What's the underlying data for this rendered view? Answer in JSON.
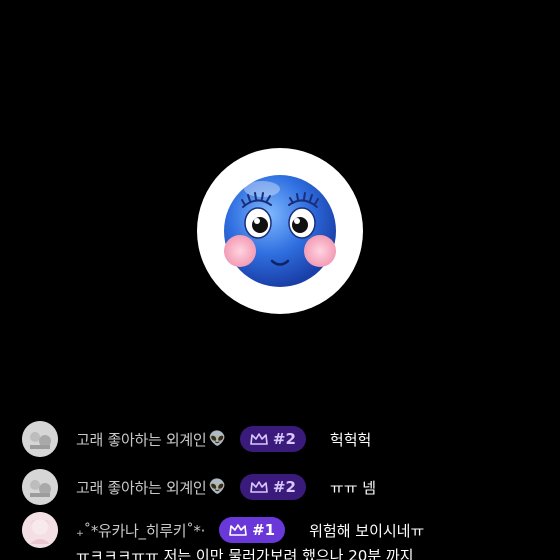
{
  "profile": {
    "icon": "blue-blushing-smiley-icon"
  },
  "colors": {
    "background": "#000000",
    "badge_rank2": "#3a1a7a",
    "badge_rank1": "#6a38d8"
  },
  "chat": [
    {
      "nickname": "고래 좋아하는 외계인",
      "emoji": "👽",
      "badge": "#2",
      "message": "헉헉헉"
    },
    {
      "nickname": "고래 좋아하는 외계인",
      "emoji": "👽",
      "badge": "#2",
      "message": "ㅠㅠ 넴"
    },
    {
      "nickname": "₊˚*유카나_히루키˚*·",
      "emoji": "",
      "badge": "#1",
      "message": "위험해 보이시네ㅠ",
      "message_continued": "ㅠㅋㅋㅋㅠㅠ 저는 이만 물러가보려 했으나 20분 까지"
    }
  ]
}
